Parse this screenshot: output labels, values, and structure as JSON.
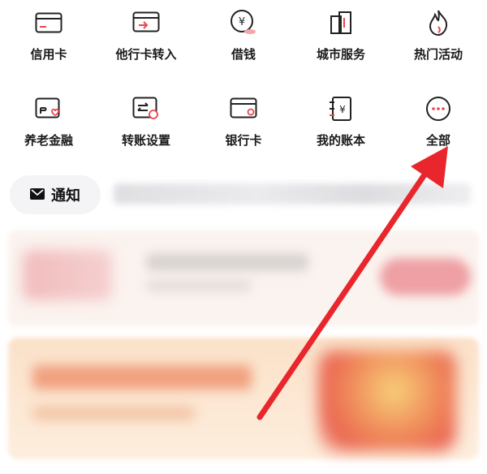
{
  "shortcuts_row1": [
    {
      "label": "信用卡",
      "icon": "credit-card-icon"
    },
    {
      "label": "他行卡转入",
      "icon": "card-transfer-in-icon"
    },
    {
      "label": "借钱",
      "icon": "yuan-coin-icon"
    },
    {
      "label": "城市服务",
      "icon": "city-buildings-icon"
    },
    {
      "label": "热门活动",
      "icon": "flame-icon"
    }
  ],
  "shortcuts_row2": [
    {
      "label": "养老金融",
      "icon": "pension-card-icon"
    },
    {
      "label": "转账设置",
      "icon": "transfer-settings-icon"
    },
    {
      "label": "银行卡",
      "icon": "bank-card-icon"
    },
    {
      "label": "我的账本",
      "icon": "ledger-icon"
    },
    {
      "label": "全部",
      "icon": "more-dots-icon"
    }
  ],
  "notice": {
    "label": "通知",
    "icon": "envelope-icon"
  },
  "annotation": {
    "color": "#e8262c",
    "target": "全部"
  },
  "colors": {
    "accent": "#e8474d",
    "text": "#1a1a1a"
  }
}
